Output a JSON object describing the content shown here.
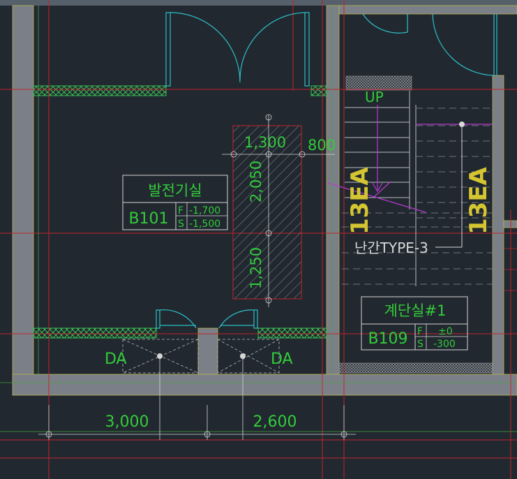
{
  "colors": {
    "background": "#212830",
    "wall": "#7b8088",
    "wall_edge": "#b8b24a",
    "grid_line": "#c2232b",
    "door": "#2ec0c8",
    "dimension": "#d6d6d6",
    "text_green": "#33cc3a",
    "text_yellow": "#e6d437",
    "magenta": "#b73ad0",
    "stair": "#b9bcc2",
    "ea_text": "#d4c531",
    "leader_text": "#d8d8d8"
  },
  "rooms": {
    "generator": {
      "name": "발전기실",
      "code": "B101",
      "f_label": "F",
      "f_value": "-1,700",
      "s_label": "S",
      "s_value": "-1,500"
    },
    "stair": {
      "name": "계단실#1",
      "code": "B109",
      "f_label": "F",
      "f_value": "±0",
      "s_label": "S",
      "s_value": "-300"
    }
  },
  "dimensions": {
    "pad_width": "1,300",
    "pad_gap": "800",
    "pad_upper": "2,050",
    "pad_lower": "1,250",
    "bottom_left": "3,000",
    "bottom_right": "2,600"
  },
  "labels": {
    "up": "UP",
    "da_left": "DA",
    "da_right": "DA",
    "ea_left": "13EA",
    "ea_right": "13EA",
    "railing": "난간TYPE-3"
  }
}
